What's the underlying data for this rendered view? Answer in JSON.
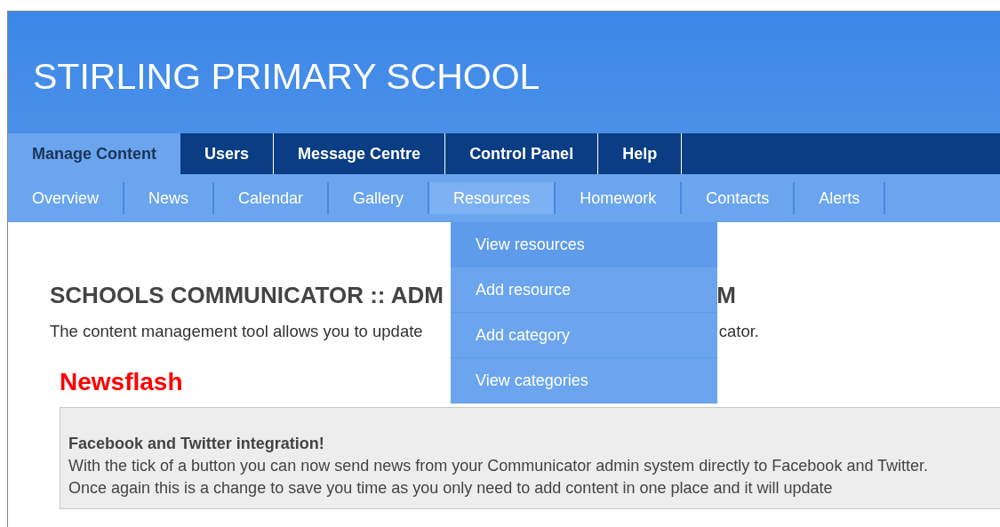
{
  "header": {
    "title": "STIRLING PRIMARY SCHOOL"
  },
  "tabs": [
    {
      "label": "Manage Content",
      "selected": true
    },
    {
      "label": "Users",
      "selected": false
    },
    {
      "label": "Message Centre",
      "selected": false
    },
    {
      "label": "Control Panel",
      "selected": false
    },
    {
      "label": "Help",
      "selected": false
    }
  ],
  "subnav": [
    {
      "label": "Overview",
      "selected": false
    },
    {
      "label": "News",
      "selected": false
    },
    {
      "label": "Calendar",
      "selected": false
    },
    {
      "label": "Gallery",
      "selected": false
    },
    {
      "label": "Resources",
      "selected": true
    },
    {
      "label": "Homework",
      "selected": false
    },
    {
      "label": "Contacts",
      "selected": false
    },
    {
      "label": "Alerts",
      "selected": false
    }
  ],
  "dropdown": [
    {
      "label": "View resources",
      "selected": true
    },
    {
      "label": "Add resource",
      "selected": false
    },
    {
      "label": "Add category",
      "selected": false
    },
    {
      "label": "View categories",
      "selected": false
    }
  ],
  "heading": {
    "left": "SCHOOLS COMMUNICATOR :: ADM",
    "right": "M"
  },
  "intro": {
    "left": "The content management tool allows you to update",
    "right": "cator."
  },
  "newsflash": {
    "title": "Newsflash",
    "item_title": "Facebook and Twitter integration!",
    "body": "With the tick of a button you can now send news from your Communicator admin system directly to Facebook and Twitter. Once again this is a change to save you time as you only need to add content in one place and it will update"
  }
}
